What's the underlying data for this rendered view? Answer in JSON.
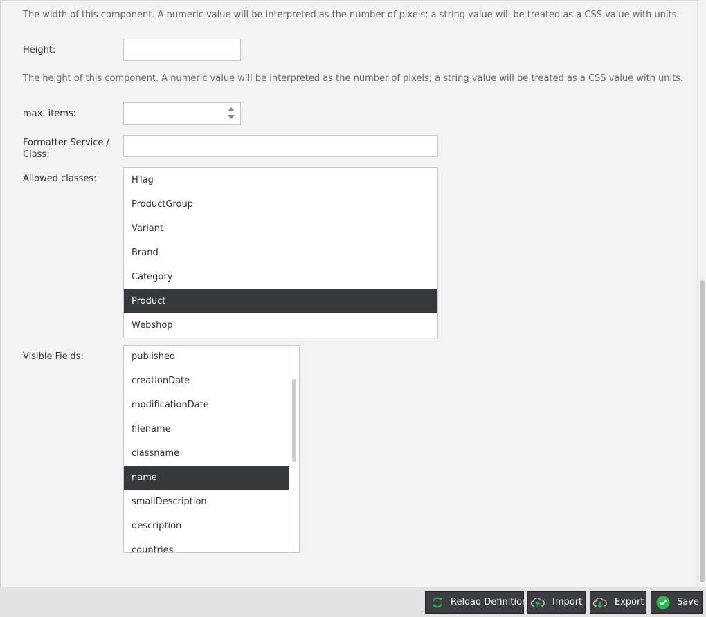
{
  "form": {
    "width_desc": "The width of this component. A numeric value will be interpreted as the number of pixels; a string value will be treated as a CSS value with units.",
    "height_label": "Height:",
    "height_value": "",
    "height_desc": "The height of this component. A numeric value will be interpreted as the number of pixels; a string value will be treated as a CSS value with units.",
    "max_items_label": "max. items:",
    "max_items_value": "",
    "formatter_label_line1": "Formatter Service /",
    "formatter_label_line2": "Class:",
    "formatter_value": "",
    "allowed_classes_label": "Allowed classes:",
    "allowed_classes": [
      {
        "label": "HTag",
        "selected": false
      },
      {
        "label": "ProductGroup",
        "selected": false
      },
      {
        "label": "Variant",
        "selected": false
      },
      {
        "label": "Brand",
        "selected": false
      },
      {
        "label": "Category",
        "selected": false
      },
      {
        "label": "Product",
        "selected": true
      },
      {
        "label": "Webshop",
        "selected": false
      }
    ],
    "visible_fields_label": "Visible Fields:",
    "visible_fields": [
      {
        "label": "published",
        "selected": false
      },
      {
        "label": "creationDate",
        "selected": false
      },
      {
        "label": "modificationDate",
        "selected": false
      },
      {
        "label": "filename",
        "selected": false
      },
      {
        "label": "classname",
        "selected": false
      },
      {
        "label": "name",
        "selected": true
      },
      {
        "label": "smallDescription",
        "selected": false
      },
      {
        "label": "description",
        "selected": false
      },
      {
        "label": "countries",
        "selected": false
      }
    ]
  },
  "toolbar": {
    "reload_label": "Reload Definition",
    "import_label": "Import",
    "export_label": "Export",
    "save_label": "Save"
  },
  "icons": {
    "reload": "reload-icon",
    "import": "cloud-upload-icon",
    "export": "cloud-download-icon",
    "save": "check-circle-icon"
  },
  "colors": {
    "selection": "#36383b",
    "button_bg": "#3a3c3f",
    "accent_green": "#2fb84f"
  }
}
